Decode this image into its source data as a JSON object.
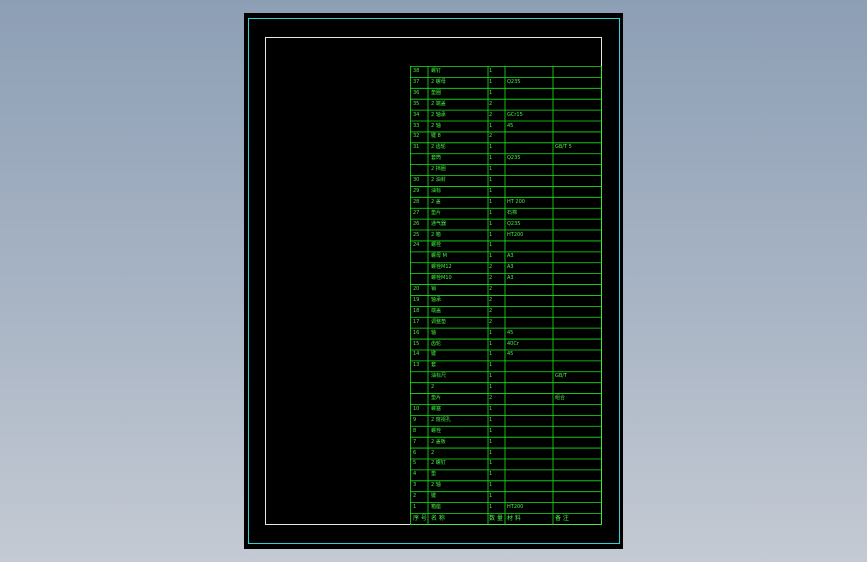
{
  "drawing": {
    "colors": {
      "background_top": "#8d9fb5",
      "background_bottom": "#c4cad3",
      "sheet": "#000000",
      "outer_border": "#2fd1d9",
      "inner_border": "#e6e6e6",
      "table_lines": "#19e619",
      "table_text": "#45f045"
    },
    "bom_header": {
      "no": "序 号",
      "name": "名 称",
      "qty": "数 量",
      "material": "材 料",
      "note": "备 注"
    },
    "bom_rows": [
      {
        "no": "38",
        "name": "螺钉",
        "qty": "1",
        "material": "",
        "note": ""
      },
      {
        "no": "37",
        "name": "2 螺母",
        "qty": "1",
        "material": "Q235",
        "note": ""
      },
      {
        "no": "36",
        "name": "垫圈",
        "qty": "1",
        "material": "",
        "note": ""
      },
      {
        "no": "35",
        "name": "2 端盖",
        "qty": "2",
        "material": "",
        "note": ""
      },
      {
        "no": "34",
        "name": "2 轴承",
        "qty": "2",
        "material": "GCr15",
        "note": ""
      },
      {
        "no": "33",
        "name": "2 轴",
        "qty": "1",
        "material": "45",
        "note": ""
      },
      {
        "no": "32",
        "name": "键 8",
        "qty": "2",
        "material": "",
        "note": ""
      },
      {
        "no": "31",
        "name": "2 齿轮",
        "qty": "1",
        "material": "",
        "note": "GB/T 5"
      },
      {
        "no": "",
        "name": "套筒",
        "qty": "1",
        "material": "Q235",
        "note": ""
      },
      {
        "no": "",
        "name": "2 挡圈",
        "qty": "1",
        "material": "",
        "note": ""
      },
      {
        "no": "30",
        "name": "2 油封",
        "qty": "1",
        "material": "",
        "note": ""
      },
      {
        "no": "29",
        "name": "油标",
        "qty": "1",
        "material": "",
        "note": ""
      },
      {
        "no": "28",
        "name": "2 盖",
        "qty": "1",
        "material": "HT 200",
        "note": ""
      },
      {
        "no": "27",
        "name": "垫片",
        "qty": "1",
        "material": "石棉",
        "note": ""
      },
      {
        "no": "26",
        "name": "通气器",
        "qty": "1",
        "material": "Q235",
        "note": ""
      },
      {
        "no": "25",
        "name": "2 箱",
        "qty": "1",
        "material": "HT200",
        "note": ""
      },
      {
        "no": "24",
        "name": "螺栓",
        "qty": "1",
        "material": "",
        "note": ""
      },
      {
        "no": "",
        "name": "螺母 M",
        "qty": "1",
        "material": "A3",
        "note": ""
      },
      {
        "no": "",
        "name": "螺栓M12",
        "qty": "2",
        "material": "A3",
        "note": ""
      },
      {
        "no": "",
        "name": "螺栓M10",
        "qty": "2",
        "material": "A3",
        "note": ""
      },
      {
        "no": "20",
        "name": "销",
        "qty": "2",
        "material": "",
        "note": ""
      },
      {
        "no": "19",
        "name": "轴承",
        "qty": "2",
        "material": "",
        "note": ""
      },
      {
        "no": "18",
        "name": "端盖",
        "qty": "2",
        "material": "",
        "note": ""
      },
      {
        "no": "17",
        "name": "调整垫",
        "qty": "2",
        "material": "",
        "note": ""
      },
      {
        "no": "16",
        "name": "轴",
        "qty": "1",
        "material": "45",
        "note": ""
      },
      {
        "no": "15",
        "name": "齿轮",
        "qty": "1",
        "material": "40Cr",
        "note": ""
      },
      {
        "no": "14",
        "name": "键",
        "qty": "1",
        "material": "45",
        "note": ""
      },
      {
        "no": "13",
        "name": "套",
        "qty": "1",
        "material": "",
        "note": ""
      },
      {
        "no": "",
        "name": "油标尺",
        "qty": "1",
        "material": "",
        "note": "GB/T"
      },
      {
        "no": "",
        "name": "2",
        "qty": "1",
        "material": "",
        "note": ""
      },
      {
        "no": "",
        "name": "垫片",
        "qty": "2",
        "material": "",
        "note": "组合"
      },
      {
        "no": "10",
        "name": "螺塞",
        "qty": "1",
        "material": "",
        "note": ""
      },
      {
        "no": "9",
        "name": "2 窥视孔",
        "qty": "1",
        "material": "",
        "note": ""
      },
      {
        "no": "8",
        "name": "螺栓",
        "qty": "1",
        "material": "",
        "note": ""
      },
      {
        "no": "7",
        "name": "2 盖板",
        "qty": "1",
        "material": "",
        "note": ""
      },
      {
        "no": "6",
        "name": "2",
        "qty": "1",
        "material": "",
        "note": ""
      },
      {
        "no": "5",
        "name": "2 螺钉",
        "qty": "1",
        "material": "",
        "note": ""
      },
      {
        "no": "4",
        "name": "垫",
        "qty": "1",
        "material": "",
        "note": ""
      },
      {
        "no": "3",
        "name": "2 轴",
        "qty": "1",
        "material": "",
        "note": ""
      },
      {
        "no": "2",
        "name": "键",
        "qty": "1",
        "material": "",
        "note": ""
      },
      {
        "no": "1",
        "name": "箱座",
        "qty": "1",
        "material": "HT200",
        "note": ""
      }
    ]
  }
}
